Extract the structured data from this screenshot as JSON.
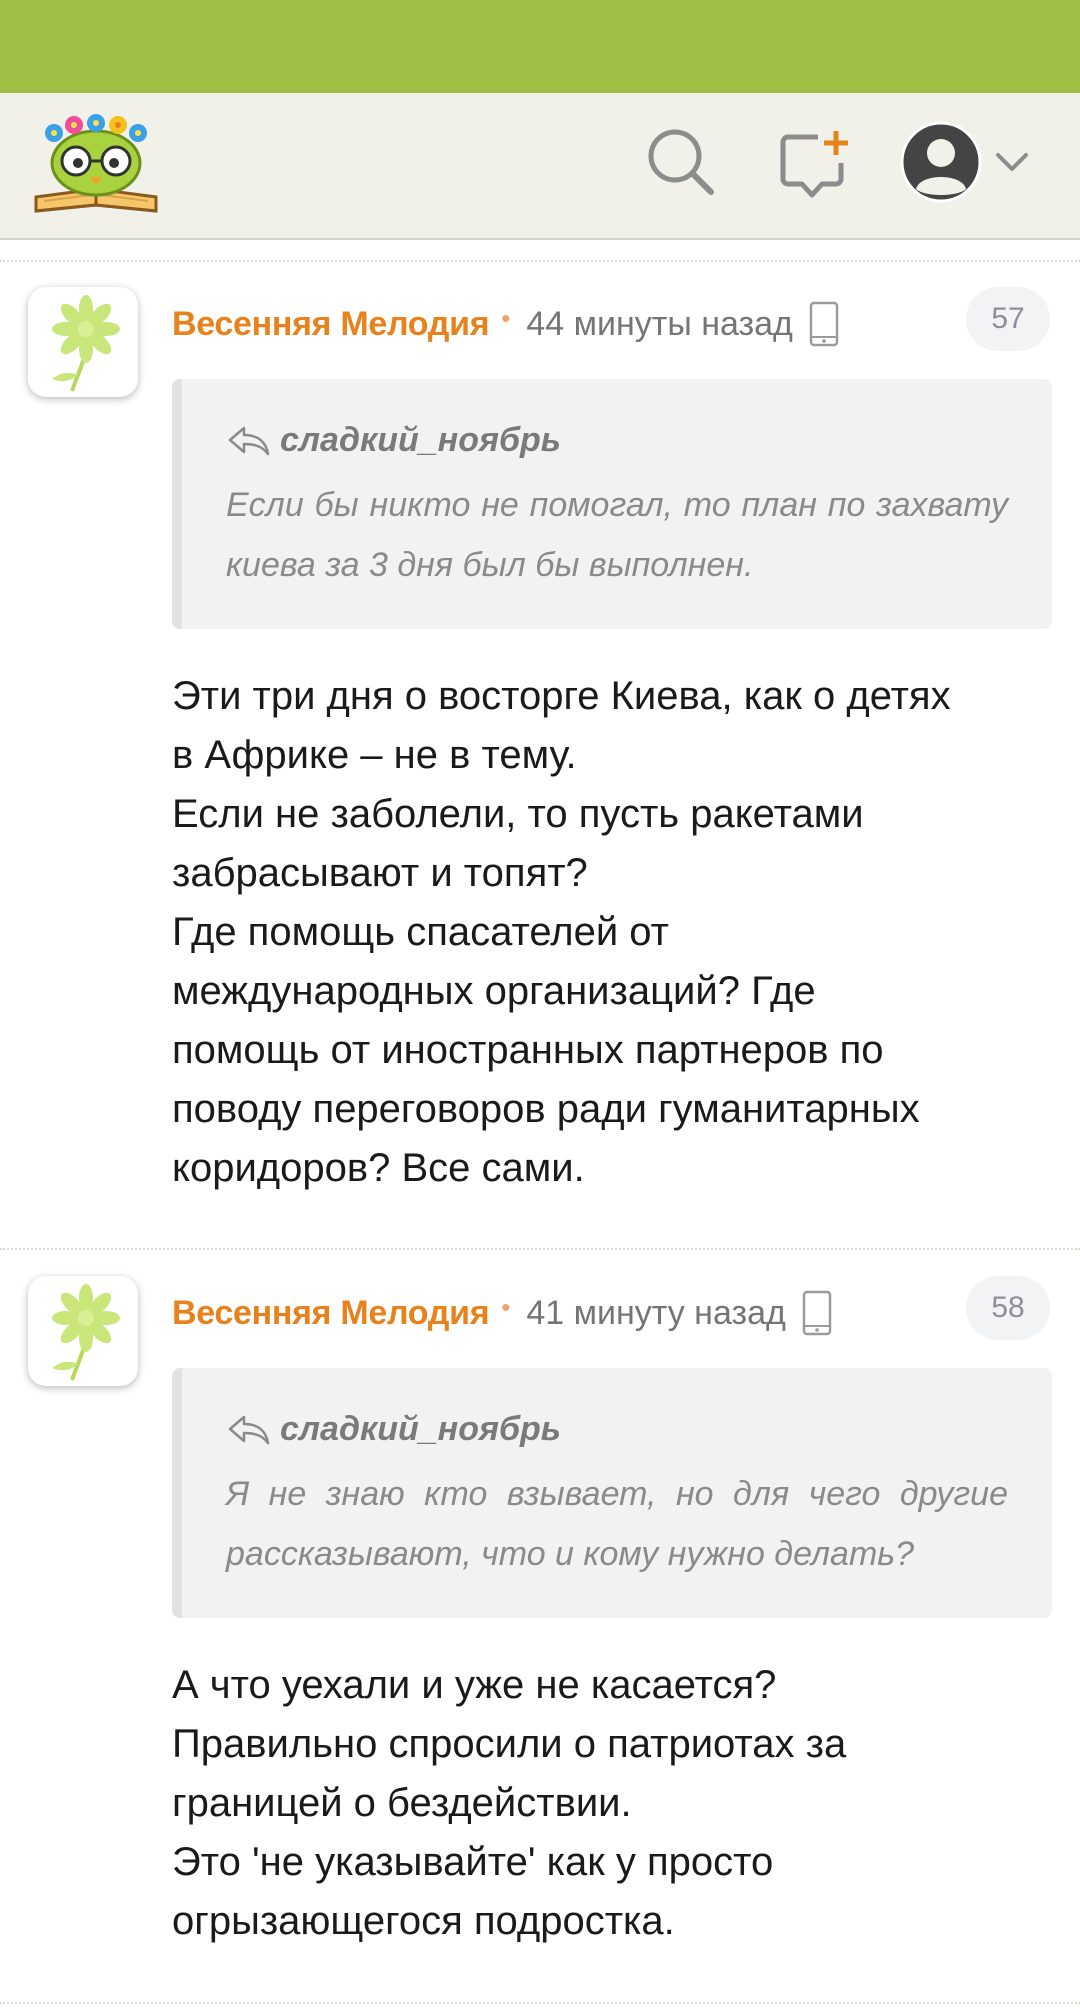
{
  "header": {
    "logo_name": "owl-with-flowers-on-book",
    "icons": [
      "search-icon",
      "add-comment-icon",
      "avatar-icon",
      "chevron-down-icon"
    ]
  },
  "colors": {
    "status_bar": "#9dc044",
    "header_bg": "#f1f1ea",
    "author": "#e8821c",
    "accent_leaf": "#c8e67a"
  },
  "comments": [
    {
      "author": "Весенняя Мелодия",
      "separator": "•",
      "time": "44 минуты назад",
      "number": "57",
      "device_icon": "smartphone-icon",
      "quote": {
        "author": "сладкий_ноябрь",
        "text": "Если бы никто не помогал, то план по захвату киева за 3 дня был бы выполнен."
      },
      "lines": [
        "Эти три дня о восторге Киева, как о детях",
        "в Африке – не в тему.",
        "Если не заболели, то пусть ракетами",
        "забрасывают и топят?",
        "Где помощь спасателей от",
        "международных организаций? Где",
        "помощь от иностранных партнеров по",
        "поводу переговоров ради гуманитарных",
        "коридоров? Все сами."
      ]
    },
    {
      "author": "Весенняя Мелодия",
      "separator": "•",
      "time": "41 минуту назад",
      "number": "58",
      "device_icon": "smartphone-icon",
      "quote": {
        "author": "сладкий_ноябрь",
        "text": "Я не знаю кто взывает, но для чего другие рассказывают, что и кому нужно делать?"
      },
      "lines": [
        "А что уехали и уже не касается?",
        "Правильно спросили о патриотах за",
        "границей о бездействии.",
        "Это 'не указывайте' как у просто",
        "огрызающегося подростка."
      ]
    }
  ]
}
